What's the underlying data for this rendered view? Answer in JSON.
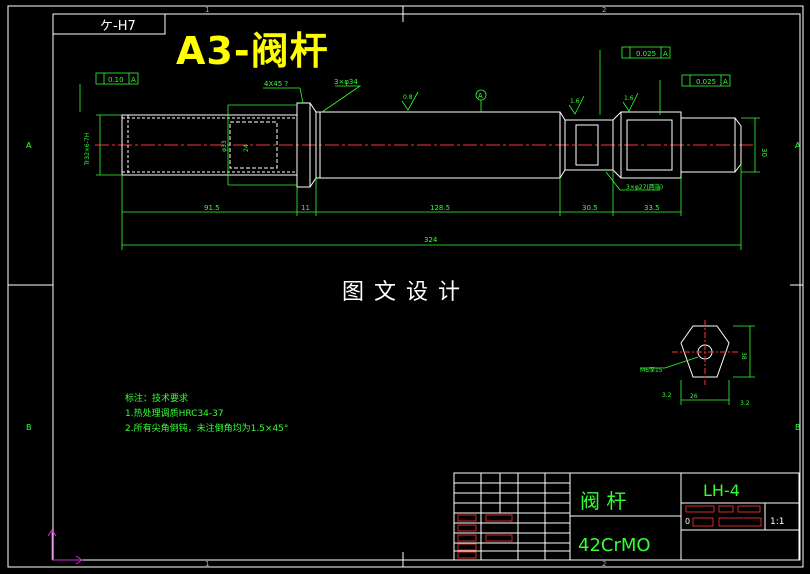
{
  "title_overlay": "A3-阀杆",
  "center_watermark": "图文设计",
  "fit_label": "ケ-H7",
  "zone_marks": {
    "col1": "1",
    "col2": "2",
    "rowA": "A",
    "rowB": "B"
  },
  "dimensions": {
    "d_915": "91.5",
    "d_11": "11",
    "d_1285": "128.5",
    "d_305": "30.5",
    "d_335": "33.5",
    "d_324": "324",
    "d_30": "30",
    "chamfer_4x45": "4X45 ?",
    "chamfer_3x34": "3×φ34",
    "groove_3x27": "3×φ27(两端)",
    "thread": "Tr32×6-7H",
    "bore_33": "φ33",
    "d_26": "26",
    "d_24": "24",
    "d_38": "38",
    "m6": "M6深15"
  },
  "tolerances": {
    "t1": "0.10",
    "t2": "0.025",
    "t3": "0.025",
    "t1_ref": "A",
    "t2_ref": "A",
    "t3_ref": "A",
    "datum": "A"
  },
  "roughness": {
    "r1": "0.8",
    "r2": "1.6",
    "r3": "1.6",
    "r4": "3.2",
    "r5": "3.2"
  },
  "notes": {
    "heading": "标注：技术要求",
    "line1": "1.热处理调质HRC34-37",
    "line2": "2.所有尖角倒钝，未注倒角均为1.5×45°"
  },
  "title_block": {
    "part_name": "阀 杆",
    "material": "42CrMO",
    "drawing_no": "LH-4",
    "scale": "1:1",
    "sheet": "0"
  },
  "colors": {
    "frame": "#ffffff",
    "dim": "#33ff33",
    "center": "#ff3333",
    "title": "#ffff00",
    "tb_red": "#ff3333",
    "axis": "#cc33cc"
  }
}
